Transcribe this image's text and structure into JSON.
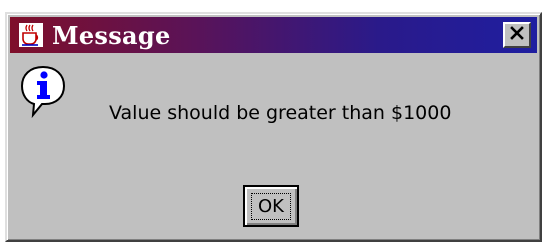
{
  "window": {
    "title": "Message",
    "title_icon": "java-cup-icon",
    "close_icon": "close-icon"
  },
  "message": {
    "icon": "information-icon",
    "text": "Value should be greater than $1000"
  },
  "buttons": {
    "ok_label": "OK"
  },
  "colors": {
    "dialog_background": "#c0c0c0",
    "titlebar_gradient_start": "#7f0f2a",
    "titlebar_gradient_end": "#1f1ea0",
    "title_text": "#ffffff",
    "info_icon_fill": "#0000ff"
  }
}
